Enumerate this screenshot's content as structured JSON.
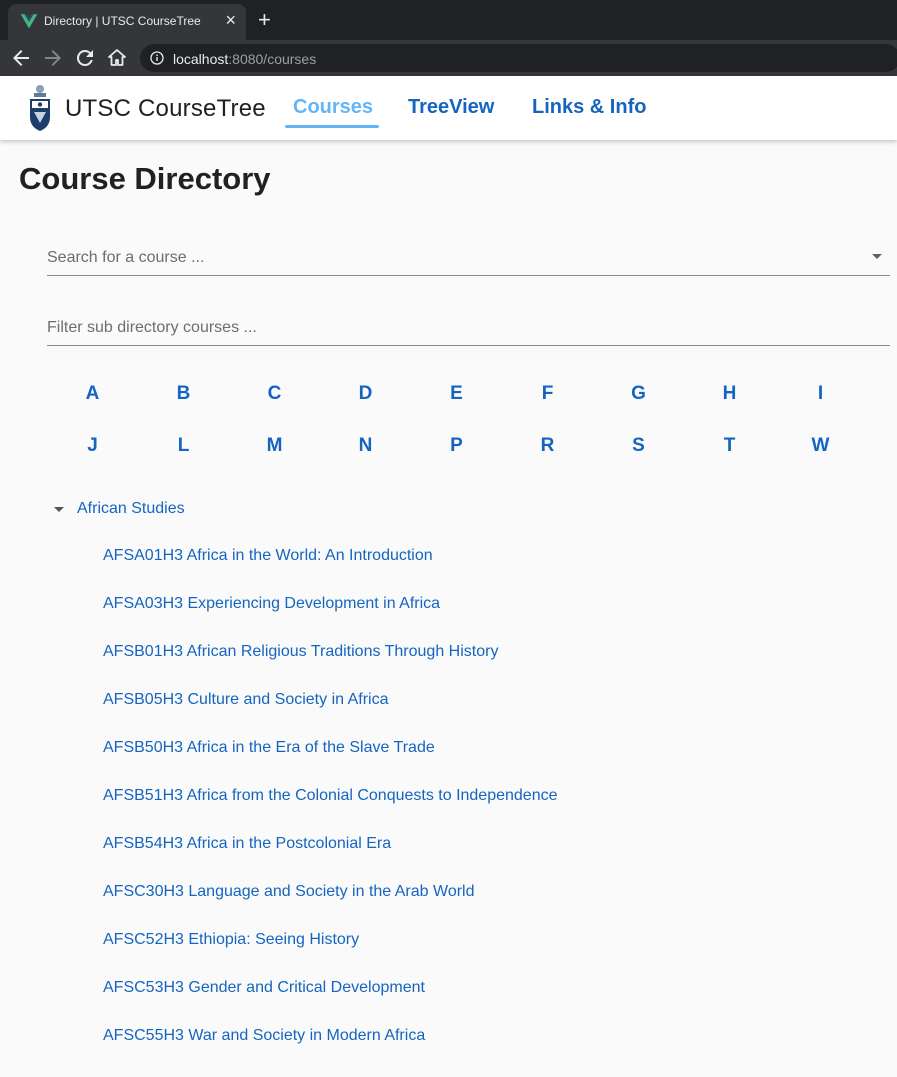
{
  "browser": {
    "tab_title": "Directory | UTSC CourseTree",
    "url_host": "localhost",
    "url_path": ":8080/courses"
  },
  "header": {
    "brand_bold": "UTSC",
    "brand_rest": " CourseTree",
    "nav": [
      "Courses",
      "TreeView",
      "Links & Info"
    ],
    "active_nav": "Courses"
  },
  "main": {
    "title": "Course Directory",
    "search_placeholder": "Search for a course ...",
    "filter_placeholder": "Filter sub directory courses ...",
    "letters_row1": [
      "A",
      "B",
      "C",
      "D",
      "E",
      "F",
      "G",
      "H",
      "I"
    ],
    "letters_row2": [
      "J",
      "L",
      "M",
      "N",
      "P",
      "R",
      "S",
      "T",
      "W"
    ],
    "group": {
      "label": "African Studies",
      "courses": [
        "AFSA01H3 Africa in the World: An Introduction",
        "AFSA03H3 Experiencing Development in Africa",
        "AFSB01H3 African Religious Traditions Through History",
        "AFSB05H3 Culture and Society in Africa",
        "AFSB50H3 Africa in the Era of the Slave Trade",
        "AFSB51H3 Africa from the Colonial Conquests to Independence",
        "AFSB54H3 Africa in the Postcolonial Era",
        "AFSC30H3 Language and Society in the Arab World",
        "AFSC52H3 Ethiopia: Seeing History",
        "AFSC53H3 Gender and Critical Development",
        "AFSC55H3 War and Society in Modern Africa"
      ]
    }
  },
  "colors": {
    "link": "#1565c0",
    "active": "#64b5f6",
    "chrome_dark": "#202124",
    "chrome": "#35363a"
  }
}
